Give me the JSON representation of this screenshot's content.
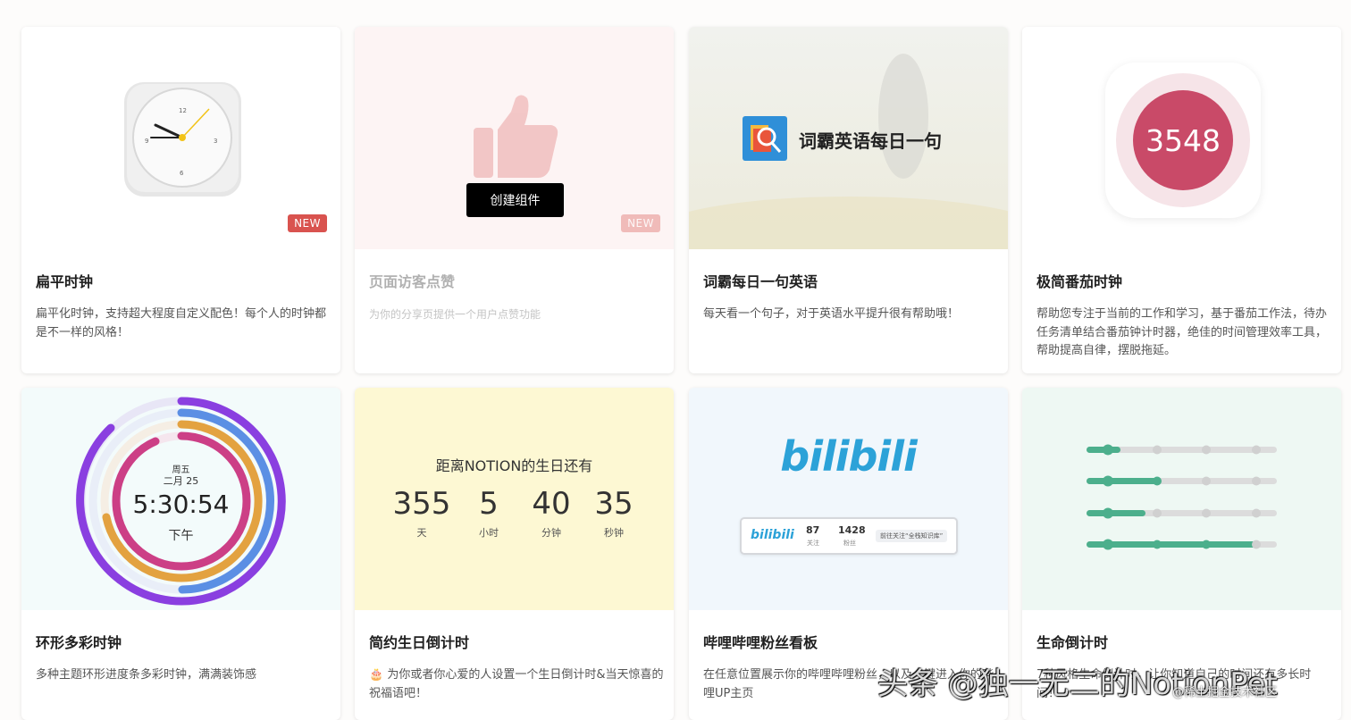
{
  "cards": [
    {
      "title": "扁平时钟",
      "desc": "扁平化时钟，支持超大程度自定义配色！每个人的时钟都是不一样的风格！",
      "badge": "NEW"
    },
    {
      "title": "页面访客点赞",
      "desc": "为你的分享页提供一个用户点赞功能",
      "badge": "NEW",
      "button": "创建组件"
    },
    {
      "title": "词霸每日一句英语",
      "desc": "每天看一个句子，对于英语水平提升很有帮助哦！",
      "preview_text": "词霸英语每日一句"
    },
    {
      "title": "极简番茄时钟",
      "desc": "帮助您专注于当前的工作和学习，基于番茄工作法，待办任务清单结合番茄钟计时器，绝佳的时间管理效率工具，帮助提高自律，摆脱拖延。",
      "preview_number": "3548"
    },
    {
      "title": "环形多彩时钟",
      "desc": "多种主题环形进度条多彩时钟，满满装饰感",
      "clock": {
        "weekday": "周五",
        "date": "二月 25",
        "time": "5:30:54",
        "ampm": "下午"
      }
    },
    {
      "title": "简约生日倒计时",
      "desc": "🎂 为你或者你心爱的人设置一个生日倒计时&当天惊喜的祝福语吧！",
      "countdown": {
        "heading": "距离NOTION的生日还有",
        "units": [
          {
            "value": "355",
            "label": "天"
          },
          {
            "value": "5",
            "label": "小时"
          },
          {
            "value": "40",
            "label": "分钟"
          },
          {
            "value": "35",
            "label": "秒钟"
          }
        ]
      }
    },
    {
      "title": "哔哩哔哩粉丝看板",
      "desc": "在任意位置展示你的哔哩哔哩粉丝，以及一键进入你的哔哩UP主页",
      "bili": {
        "logo": "bilibili",
        "follow_num": "87",
        "follow_lbl": "关注",
        "fans_num": "1428",
        "fans_lbl": "粉丝",
        "cta": "前往关注“全栈知识库”"
      }
    },
    {
      "title": "生命倒计时",
      "desc": "7种风格生命倒计时，让你知道自己的时间还有多长时间！"
    }
  ],
  "watermark": "头条 @独一无二的NotionPet",
  "watermark2": "@稀土掘金技术社区",
  "colors": {
    "badge": "#d9534f",
    "tomato": "#c94a68",
    "bilibili": "#2ca2d8",
    "life": "#4caf8c"
  }
}
